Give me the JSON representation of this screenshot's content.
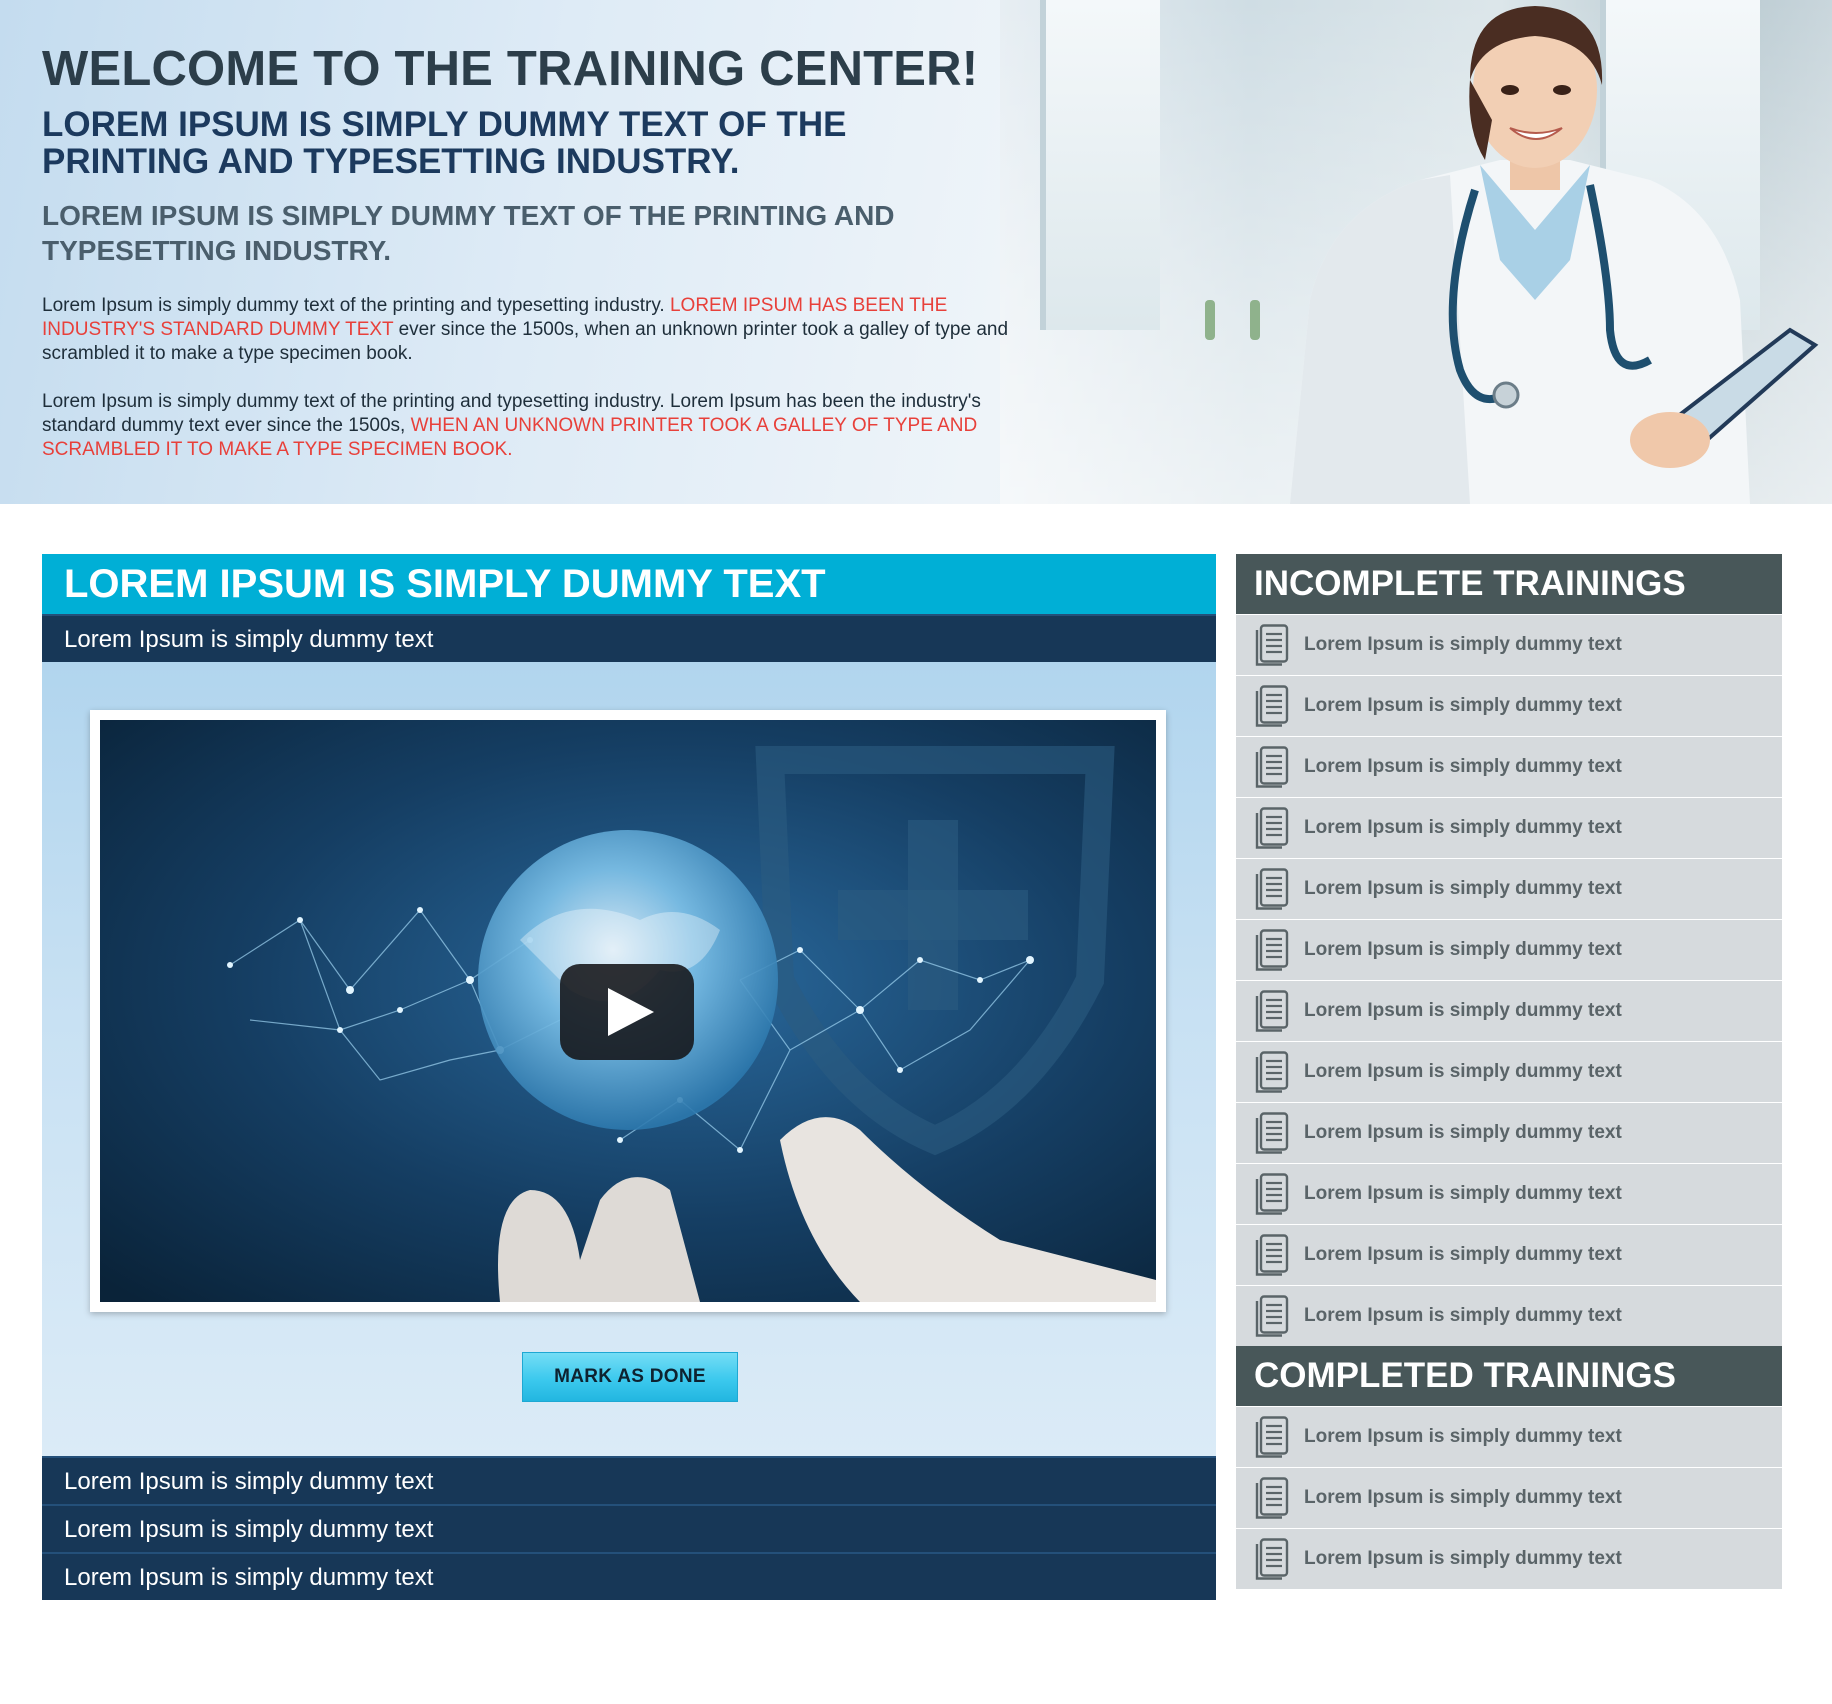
{
  "hero": {
    "title": "WELCOME TO THE TRAINING CENTER!",
    "subtitle_primary": "LOREM IPSUM IS SIMPLY DUMMY TEXT OF THE PRINTING AND TYPESETTING INDUSTRY.",
    "subtitle_secondary": "LOREM IPSUM IS SIMPLY DUMMY TEXT OF THE PRINTING AND TYPESETTING INDUSTRY.",
    "para1_start": "Lorem Ipsum is simply dummy text of the printing and typesetting industry. ",
    "para1_highlight": "LOREM IPSUM HAS BEEN THE INDUSTRY'S STANDARD DUMMY TEXT",
    "para1_end": " ever since the 1500s, when an unknown printer took a galley of type and scrambled it to make a type specimen book.",
    "para2_start": "Lorem Ipsum is simply dummy text of the printing and typesetting industry. Lorem Ipsum has been the industry's standard dummy text ever since the 1500s, ",
    "para2_highlight": "WHEN AN UNKNOWN PRINTER TOOK A GALLEY OF TYPE AND SCRAMBLED IT TO MAKE A TYPE SPECIMEN BOOK."
  },
  "main": {
    "header": "LOREM IPSUM IS SIMPLY DUMMY TEXT",
    "active_section": "Lorem Ipsum is simply dummy text",
    "mark_done_label": "MARK AS DONE",
    "sections": [
      "Lorem Ipsum is simply dummy text",
      "Lorem Ipsum is simply dummy text",
      "Lorem Ipsum is simply dummy text"
    ]
  },
  "sidebar": {
    "incomplete_title": "INCOMPLETE TRAININGS",
    "incomplete": [
      "Lorem Ipsum is simply dummy text",
      "Lorem Ipsum is simply dummy text",
      "Lorem Ipsum is simply dummy text",
      "Lorem Ipsum is simply dummy text",
      "Lorem Ipsum is simply dummy text",
      "Lorem Ipsum is simply dummy text",
      "Lorem Ipsum is simply dummy text",
      "Lorem Ipsum is simply dummy text",
      "Lorem Ipsum is simply dummy text",
      "Lorem Ipsum is simply dummy text",
      "Lorem Ipsum is simply dummy text",
      "Lorem Ipsum is simply dummy text"
    ],
    "completed_title": "COMPLETED TRAININGS",
    "completed": [
      "Lorem Ipsum is simply dummy text",
      "Lorem Ipsum is simply dummy text",
      "Lorem Ipsum is simply dummy text"
    ],
    "item_icon": "document-icon"
  },
  "colors": {
    "accent": "#00afd6",
    "dark_navy": "#173757",
    "sidebar_header": "#485759",
    "sidebar_item_bg": "#d6dadd",
    "highlight_red": "#e8403a"
  }
}
